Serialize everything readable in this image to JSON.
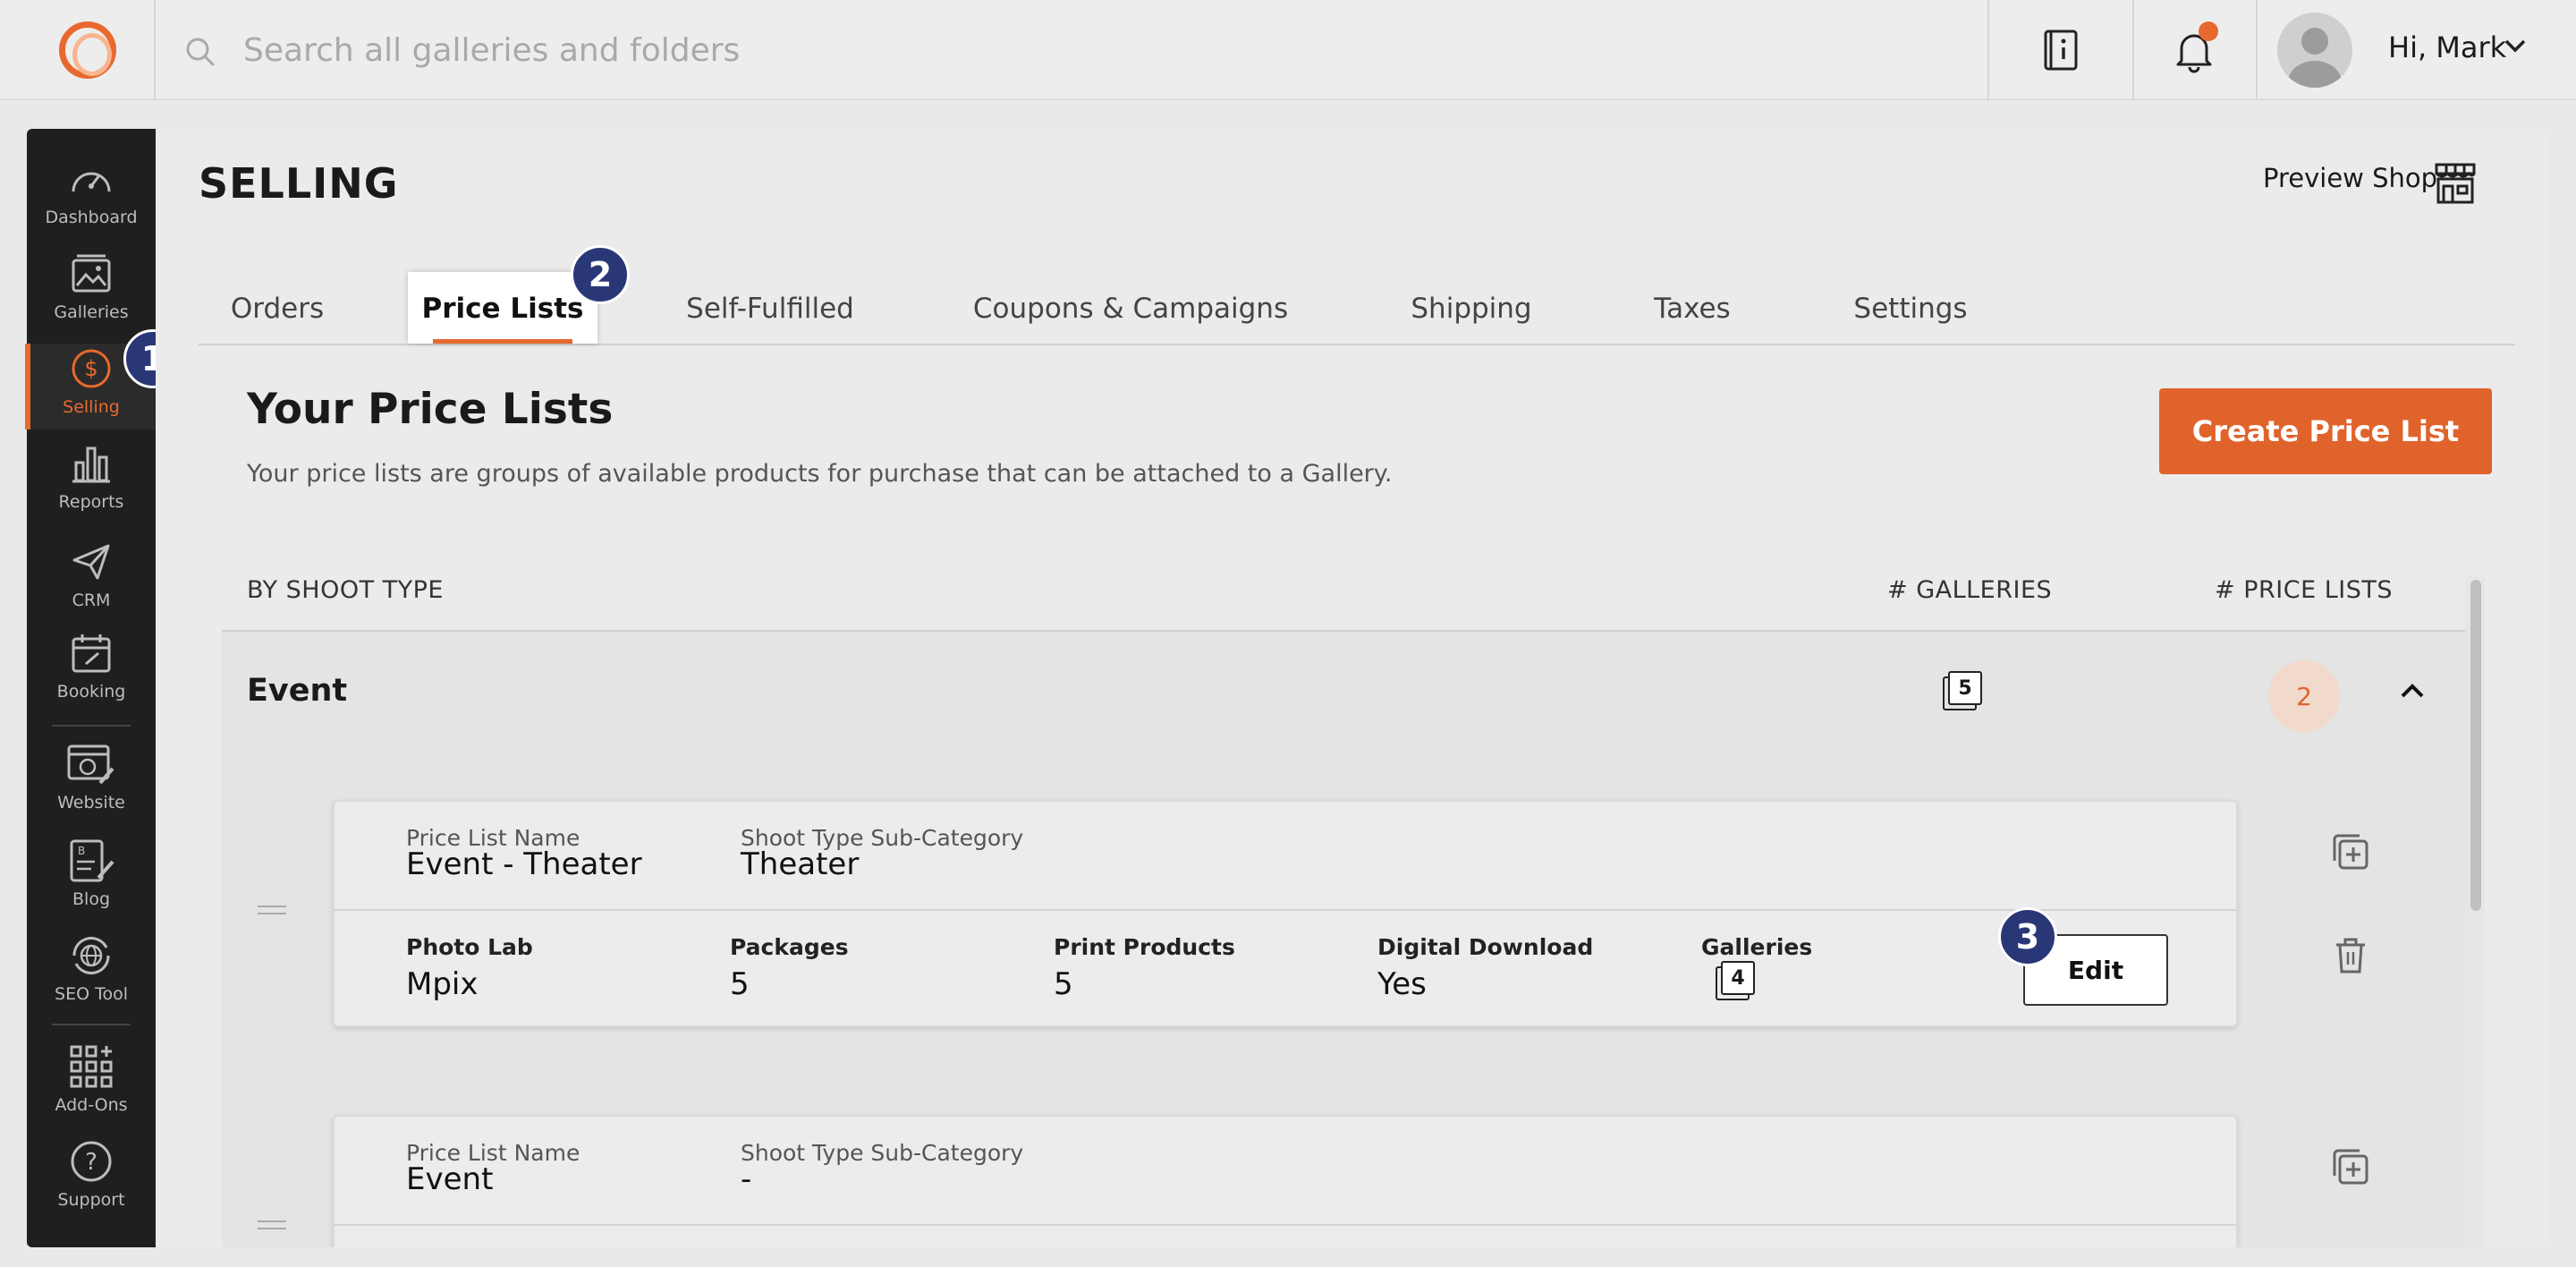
{
  "topbar": {
    "search_placeholder": "Search all galleries and folders",
    "greeting": "Hi, Mark",
    "icons": [
      "logo-icon",
      "search-icon",
      "guide-book-icon",
      "bell-icon",
      "avatar",
      "chevron-down-icon"
    ],
    "has_notification": true
  },
  "sidebar": {
    "items": [
      {
        "label": "Dashboard",
        "icon": "speedometer-icon"
      },
      {
        "label": "Galleries",
        "icon": "image-stack-icon"
      },
      {
        "label": "Selling",
        "icon": "dollar-circle-icon",
        "active": true
      },
      {
        "label": "Reports",
        "icon": "bar-chart-icon"
      },
      {
        "label": "CRM",
        "icon": "paper-plane-icon"
      },
      {
        "label": "Booking",
        "icon": "calendar-icon"
      },
      {
        "label": "Website",
        "icon": "website-edit-icon"
      },
      {
        "label": "Blog",
        "icon": "blog-edit-icon"
      },
      {
        "label": "SEO Tool",
        "icon": "globe-refresh-icon"
      },
      {
        "label": "Add-Ons",
        "icon": "grid-plus-icon"
      },
      {
        "label": "Support",
        "icon": "question-circle-icon"
      }
    ]
  },
  "page": {
    "title": "SELLING",
    "preview_shop": "Preview Shop",
    "tabs": [
      "Orders",
      "Price Lists",
      "Self-Fulfilled",
      "Coupons & Campaigns",
      "Shipping",
      "Taxes",
      "Settings"
    ],
    "active_tab": "Price Lists",
    "section_title": "Your Price Lists",
    "section_subtitle": "Your price lists are groups of available products for purchase that can be attached to a Gallery.",
    "create_button": "Create Price List",
    "columns": {
      "by_type": "BY SHOOT TYPE",
      "galleries": "# GALLERIES",
      "price_lists": "# PRICE LISTS"
    }
  },
  "badges": {
    "b1": "1",
    "b2": "2",
    "b3": "3"
  },
  "group": {
    "name": "Event",
    "galleries_count": "5",
    "price_lists_count": "2",
    "cards": [
      {
        "name_label": "Price List Name",
        "name": "Event - Theater",
        "sub_label": "Shoot Type Sub-Category",
        "sub": "Theater",
        "photo_lab_label": "Photo Lab",
        "photo_lab": "Mpix",
        "packages_label": "Packages",
        "packages": "5",
        "print_label": "Print Products",
        "print": "5",
        "digital_label": "Digital Download",
        "digital": "Yes",
        "galleries_label": "Galleries",
        "galleries": "4",
        "edit": "Edit"
      },
      {
        "name_label": "Price List Name",
        "name": "Event",
        "sub_label": "Shoot Type Sub-Category",
        "sub": "-"
      }
    ]
  },
  "colors": {
    "accent": "#e0632b",
    "badge": "#2a3777",
    "sidebar": "#1f1f1f"
  }
}
